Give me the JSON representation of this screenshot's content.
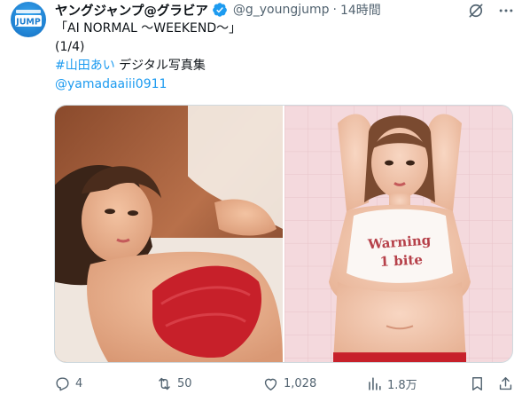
{
  "tweet": {
    "display_name": "ヤングジャンプ@グラビア",
    "handle": "@g_youngjump",
    "separator": "·",
    "time": "14時間",
    "avatar_logo_text": "JUMP",
    "lines": {
      "title": "「AI NORMAL ～WEEKEND～」",
      "part": "(1/4)",
      "hashtag": "#山田あい",
      "after_hashtag": " デジタル写真集",
      "mention": "@yamadaaiii0911"
    }
  },
  "media": {
    "shirt_text_line1": "Warning",
    "shirt_text_line2": "1 bite"
  },
  "actions": {
    "replies": "4",
    "retweets": "50",
    "likes": "1,028",
    "views": "1.8万"
  },
  "icons": {
    "verified": "verified-badge-icon",
    "grok": "grok-icon",
    "more": "more-icon",
    "reply": "reply-icon",
    "retweet": "retweet-icon",
    "like": "heart-icon",
    "views": "views-icon",
    "bookmark": "bookmark-icon",
    "share": "share-icon"
  },
  "colors": {
    "accent": "#1d9bf0",
    "secondary_text": "#536471",
    "primary_text": "#0f1419"
  }
}
